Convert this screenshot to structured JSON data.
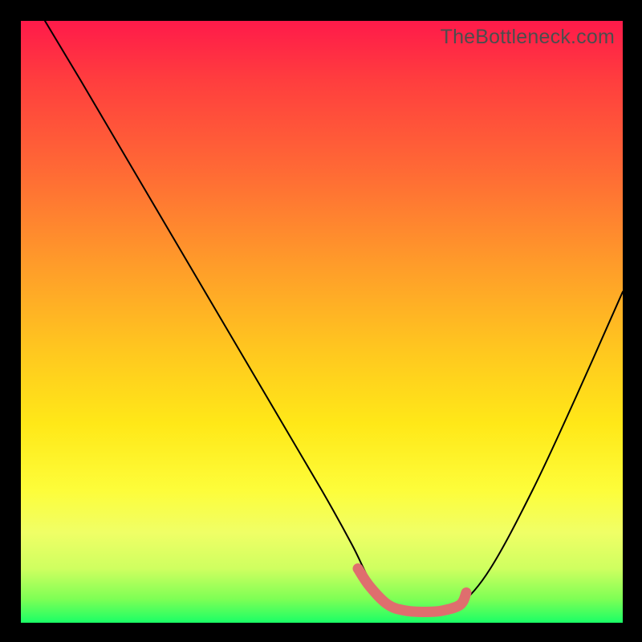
{
  "watermark": "TheBottleneck.com",
  "chart_data": {
    "type": "line",
    "title": "",
    "xlabel": "",
    "ylabel": "",
    "xlim": [
      0,
      100
    ],
    "ylim": [
      0,
      100
    ],
    "grid": false,
    "legend": false,
    "series": [
      {
        "name": "curve",
        "x": [
          4,
          10,
          20,
          30,
          40,
          50,
          55,
          58,
          61,
          64,
          67,
          70,
          73,
          78,
          85,
          92,
          100
        ],
        "y": [
          100,
          90,
          73,
          56,
          39,
          22,
          13,
          7,
          3,
          1.5,
          1.2,
          1.5,
          3,
          9,
          22,
          37,
          55
        ]
      },
      {
        "name": "highlight-band",
        "x": [
          56,
          58,
          61,
          64,
          67,
          70,
          73,
          74
        ],
        "y": [
          9,
          6,
          3,
          2.0,
          1.8,
          2.0,
          3,
          5
        ]
      }
    ],
    "colors": {
      "curve": "#000000",
      "highlight": "#e06666",
      "background_gradient": [
        "#ff1a4a",
        "#ffe818",
        "#1aff66"
      ]
    }
  }
}
